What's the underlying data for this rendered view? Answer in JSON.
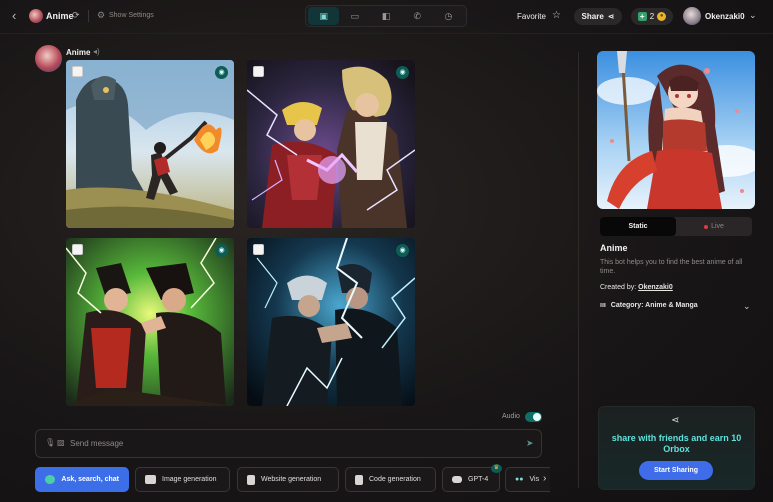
{
  "header": {
    "bot_name": "Anime",
    "show_settings": "Show Settings",
    "view_modes": [
      {
        "icon": "sidebar-layout-icon",
        "active": true
      },
      {
        "icon": "chat-icon",
        "active": false
      },
      {
        "icon": "panel-icon",
        "active": false
      },
      {
        "icon": "phone-icon",
        "active": false
      },
      {
        "icon": "history-icon",
        "active": false
      }
    ],
    "favorite": "Favorite",
    "share": "Share",
    "points": "2",
    "username": "Okenzaki0"
  },
  "message": {
    "author": "Anime",
    "images": [
      {
        "alt": "anime-battle-giant-robot"
      },
      {
        "alt": "anime-lightning-clash"
      },
      {
        "alt": "anime-green-energy-fight"
      },
      {
        "alt": "anime-blue-lightning-duel"
      }
    ]
  },
  "audio": {
    "label": "Audio",
    "enabled": true
  },
  "composer": {
    "placeholder": "Send message"
  },
  "tools": [
    {
      "label": "Ask, search, chat",
      "active": true
    },
    {
      "label": "Image generation",
      "active": false
    },
    {
      "label": "Website generation",
      "active": false
    },
    {
      "label": "Code generation",
      "active": false
    },
    {
      "label": "GPT-4",
      "active": false
    },
    {
      "label": "Vis",
      "active": false
    }
  ],
  "sidebar": {
    "tabs": {
      "static": "Static",
      "live": "Live"
    },
    "title": "Anime",
    "description": "This bot helps you to find the best anime of all time.",
    "created_by_label": "Created by:",
    "creator": "Okenzaki0",
    "category": "Category: Anime & Manga",
    "share_text": "share with friends and earn 10 Orbox",
    "start_sharing": "Start Sharing"
  },
  "colors": {
    "accent_blue": "#3c6ee8",
    "accent_teal": "#5fe2dc",
    "background": "#141213"
  }
}
